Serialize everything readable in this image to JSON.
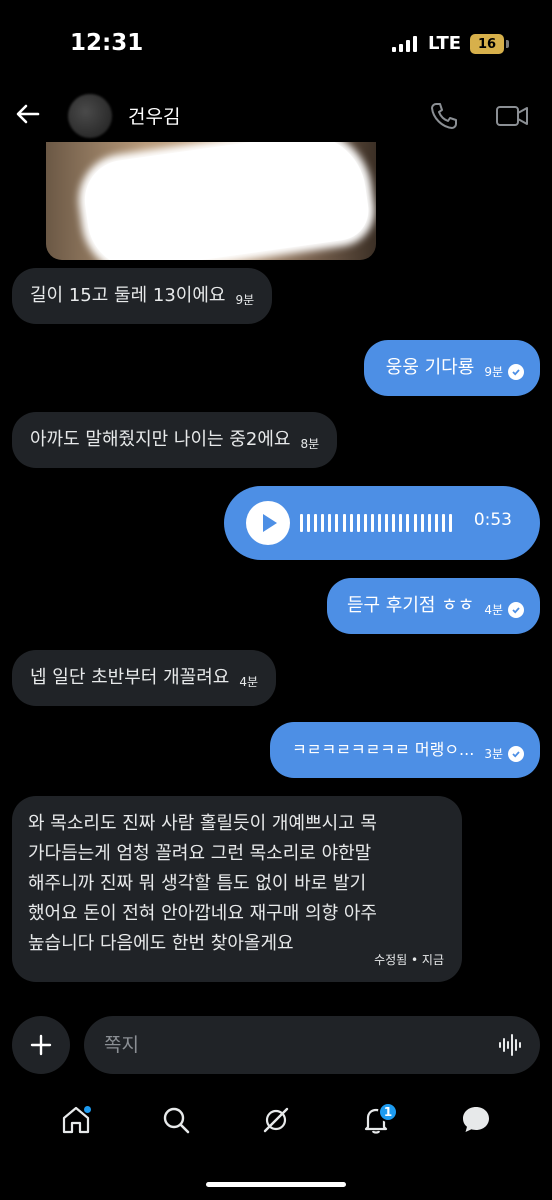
{
  "status_bar": {
    "time": "12:31",
    "network": "LTE",
    "battery": "16"
  },
  "header": {
    "contact_name": "건우김"
  },
  "messages": [
    {
      "side": "in",
      "text": "길이 15고 둘레 13이에요",
      "time": "9분"
    },
    {
      "side": "out",
      "text": "웅웅 기다룡",
      "time": "9분"
    },
    {
      "side": "in",
      "text": "아까도 말해줬지만 나이는 중2에요",
      "time": "8분"
    },
    {
      "side": "out",
      "type": "voice",
      "duration": "0:53"
    },
    {
      "side": "out",
      "text": "듣구 후기점 ㅎㅎ",
      "time": "4분"
    },
    {
      "side": "in",
      "text": "넵 일단 초반부터 개꼴려요",
      "time": "4분"
    },
    {
      "side": "out",
      "text": "ㅋㄹㅋㄹㅋㄹㅋㄹ 머랭ㅇ...",
      "time": "3분"
    },
    {
      "side": "in",
      "text": "와 목소리도 진짜 사람 홀릴듯이 개예쁘시고 목\n가다듬는게 엄청 꼴려요 그런 목소리로 야한말\n해주니까 진짜 뭐 생각할 틈도 없이 바로 발기\n했어요 돈이 전혀 안아깝네요 재구매 의향 아주\n높습니다 다음에도 한번 찾아올게요",
      "time": "수정됨 • 지금"
    }
  ],
  "compose": {
    "placeholder": "쪽지"
  },
  "tab_bar": {
    "notifications_badge": "1"
  },
  "colors": {
    "background": "#000000",
    "incoming_bubble": "#202327",
    "outgoing_bubble": "#4d8fe5",
    "accent": "#1d9bf0"
  },
  "icons": [
    "back-arrow-icon",
    "phone-icon",
    "video-camera-icon",
    "play-icon",
    "checkmark-icon",
    "plus-icon",
    "audio-wave-icon",
    "home-icon",
    "search-icon",
    "grok-icon",
    "bell-icon",
    "messages-icon"
  ]
}
